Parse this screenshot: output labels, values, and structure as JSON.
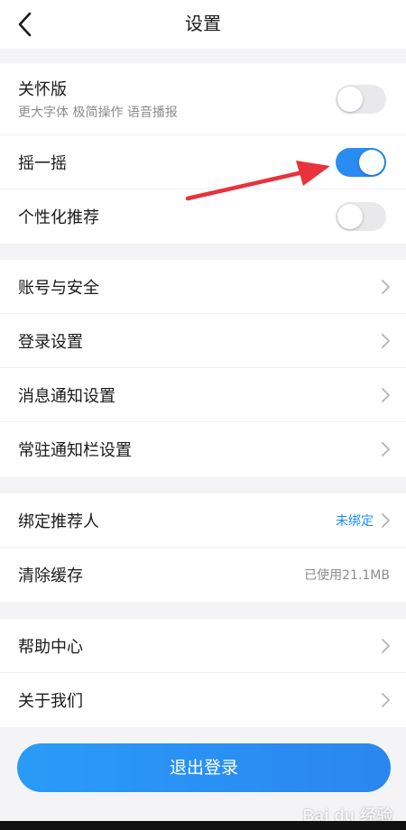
{
  "header": {
    "title": "设置",
    "back_icon": "chevron-left-icon"
  },
  "group1": {
    "items": [
      {
        "label": "关怀版",
        "sub": "更大字体 极简操作 语音播报",
        "toggle": "off"
      },
      {
        "label": "摇一摇",
        "toggle": "on"
      },
      {
        "label": "个性化推荐",
        "toggle": "off"
      }
    ]
  },
  "group2": {
    "items": [
      {
        "label": "账号与安全"
      },
      {
        "label": "登录设置"
      },
      {
        "label": "消息通知设置"
      },
      {
        "label": "常驻通知栏设置"
      }
    ]
  },
  "group3": {
    "items": [
      {
        "label": "绑定推荐人",
        "value": "未绑定"
      },
      {
        "label": "清除缓存",
        "value": "已使用21.1MB"
      }
    ]
  },
  "group4": {
    "items": [
      {
        "label": "帮助中心"
      },
      {
        "label": "关于我们"
      }
    ]
  },
  "logout": {
    "label": "退出登录"
  },
  "watermark": {
    "text": "Bai du 经验"
  },
  "colors": {
    "accent": "#2a8bf2",
    "link": "#1a8cf5",
    "annotation": "#e8323c",
    "toggle_off": "#e9e9eb"
  }
}
